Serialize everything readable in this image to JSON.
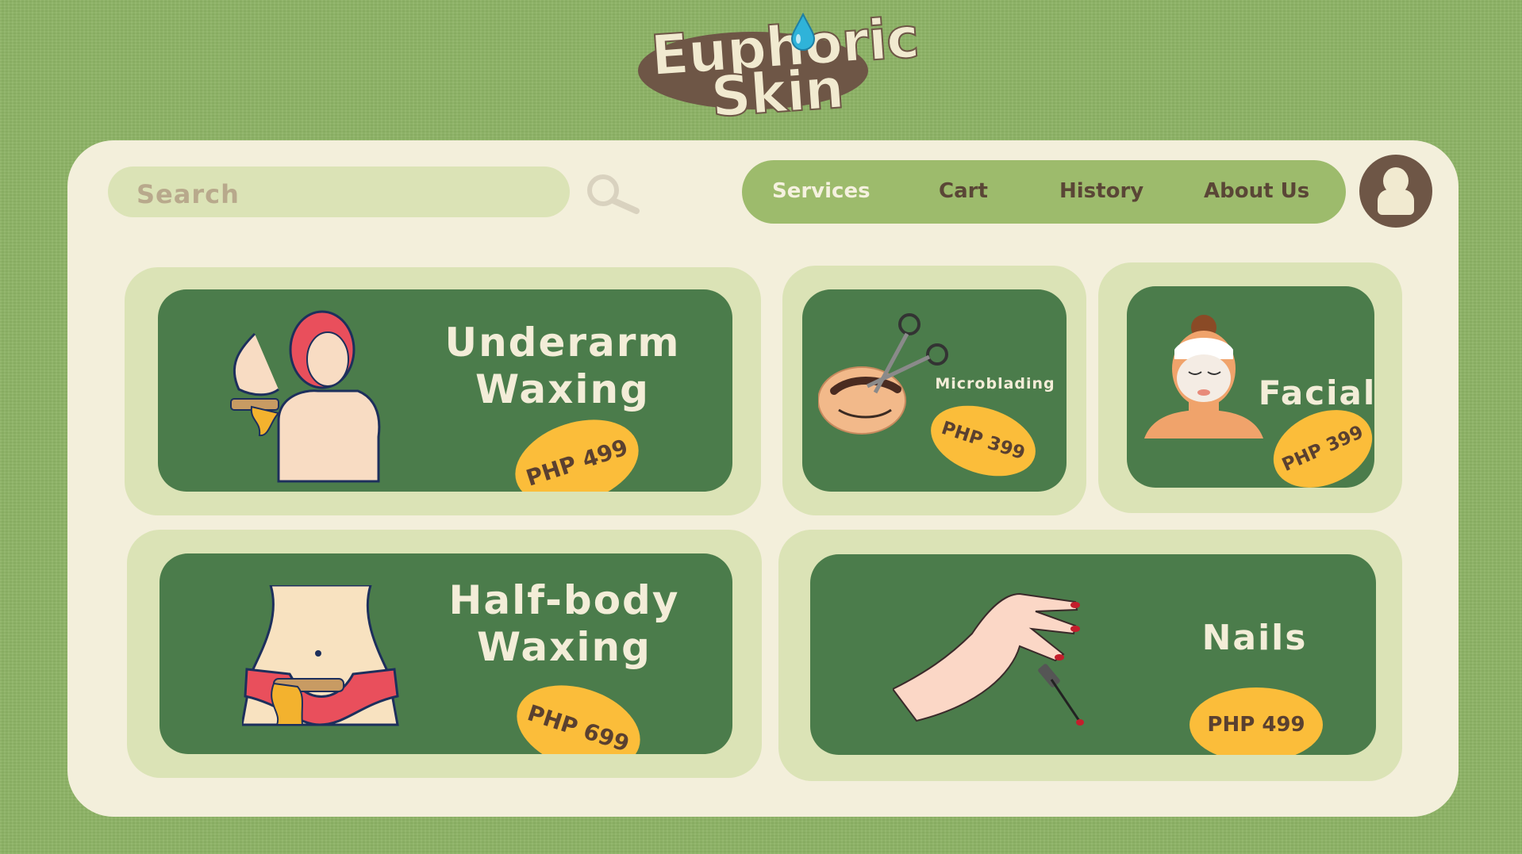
{
  "brand": {
    "name_line1": "Euphoric",
    "name_line2": "Skin",
    "colors": {
      "background": "#8db365",
      "panel": "#f3efdb",
      "card": "#4b7c4b",
      "price_tag": "#fbbd3a",
      "brown": "#6e5646"
    }
  },
  "search": {
    "placeholder": "Search",
    "icon": "magnifier-icon"
  },
  "nav": {
    "items": [
      {
        "label": "Services",
        "active": true
      },
      {
        "label": "Cart"
      },
      {
        "label": "History"
      },
      {
        "label": "About Us"
      }
    ]
  },
  "profile": {
    "icon": "user-icon"
  },
  "services": [
    {
      "title_line1": "Underarm",
      "title_line2": "Waxing",
      "price": "PHP 499",
      "icon": "underarm-waxing-illustration"
    },
    {
      "title_line1": "Microblading",
      "price": "PHP 399",
      "icon": "eyebrow-scissors-illustration"
    },
    {
      "title_line1": "Facial",
      "price": "PHP 399",
      "icon": "face-mask-illustration"
    },
    {
      "title_line1": "Half-body",
      "title_line2": "Waxing",
      "price": "PHP 699",
      "icon": "bikini-waxing-illustration"
    },
    {
      "title_line1": "Nails",
      "price": "PHP 499",
      "icon": "nail-polish-hand-illustration"
    }
  ]
}
